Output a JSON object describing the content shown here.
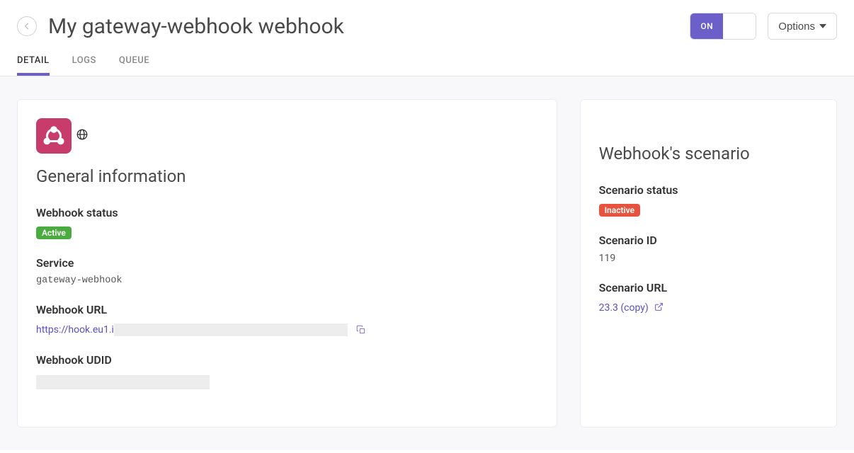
{
  "header": {
    "title": "My gateway-webhook webhook",
    "toggle": {
      "on_label": "ON"
    },
    "options_label": "Options"
  },
  "tabs": {
    "detail": "DETAIL",
    "logs": "LOGS",
    "queue": "QUEUE"
  },
  "general": {
    "section_title": "General information",
    "webhook_status": {
      "label": "Webhook status",
      "value": "Active"
    },
    "service": {
      "label": "Service",
      "value": "gateway-webhook"
    },
    "webhook_url": {
      "label": "Webhook URL",
      "prefix": "https://hook.eu1.i"
    },
    "webhook_udid": {
      "label": "Webhook UDID"
    }
  },
  "scenario": {
    "section_title": "Webhook's scenario",
    "status": {
      "label": "Scenario status",
      "value": "Inactive"
    },
    "id": {
      "label": "Scenario ID",
      "value": "119"
    },
    "url": {
      "label": "Scenario URL",
      "text": "23.3 (copy)"
    }
  }
}
